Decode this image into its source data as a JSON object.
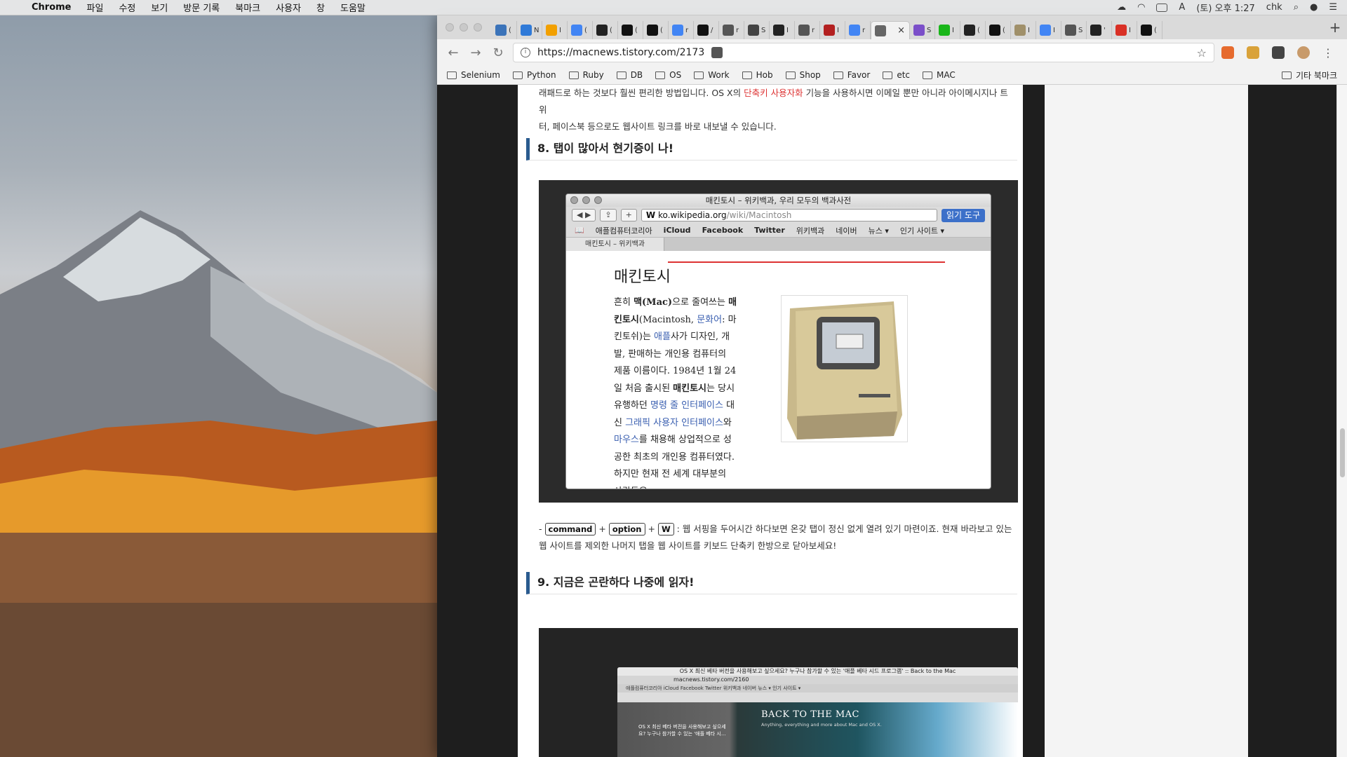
{
  "menubar": {
    "app": "Chrome",
    "items": [
      "파일",
      "수정",
      "보기",
      "방문 기록",
      "북마크",
      "사용자",
      "창",
      "도움말"
    ],
    "clock": "(토) 오후 1:27",
    "user": "chk"
  },
  "browser": {
    "tabs": [
      {
        "icon": "python-icon",
        "label": "(",
        "color": "#3b73b9"
      },
      {
        "icon": "globe-icon",
        "label": "N",
        "color": "#2f7ad8"
      },
      {
        "icon": "slides-icon",
        "label": "I",
        "color": "#f2a000"
      },
      {
        "icon": "google-icon",
        "label": "(",
        "color": "#4285f4"
      },
      {
        "icon": "x-icon",
        "label": "(",
        "color": "#222222"
      },
      {
        "icon": "github-icon",
        "label": "(",
        "color": "#111111"
      },
      {
        "icon": "github-icon",
        "label": "(",
        "color": "#111111"
      },
      {
        "icon": "google-icon",
        "label": "r",
        "color": "#4285f4"
      },
      {
        "icon": "htb-icon",
        "label": "/",
        "color": "#111111"
      },
      {
        "icon": "command-icon",
        "label": "r",
        "color": "#555555"
      },
      {
        "icon": "tool-icon",
        "label": "S",
        "color": "#444444"
      },
      {
        "icon": "im-icon",
        "label": "I",
        "color": "#222222"
      },
      {
        "icon": "command-icon",
        "label": "r",
        "color": "#555555"
      },
      {
        "icon": "m-icon",
        "label": "I",
        "color": "#b32020"
      },
      {
        "icon": "google-icon",
        "label": "r",
        "color": "#4285f4"
      },
      {
        "icon": "mac-icon",
        "label": "",
        "color": "#666666",
        "active": true
      },
      {
        "icon": "pinwheel-icon",
        "label": "S",
        "color": "#7b4fc9"
      },
      {
        "icon": "line-icon",
        "label": "I",
        "color": "#19b619"
      },
      {
        "icon": "terminal-icon",
        "label": "(",
        "color": "#222222"
      },
      {
        "icon": "github-icon",
        "label": "(",
        "color": "#111111"
      },
      {
        "icon": "image-icon",
        "label": "I",
        "color": "#a0906a"
      },
      {
        "icon": "google-icon",
        "label": "I",
        "color": "#4285f4"
      },
      {
        "icon": "command-icon",
        "label": "S",
        "color": "#555555"
      },
      {
        "icon": "dots-icon",
        "label": "'",
        "color": "#222222"
      },
      {
        "icon": "gmail-icon",
        "label": "I",
        "color": "#d93025"
      },
      {
        "icon": "github-icon",
        "label": "(",
        "color": "#111111"
      }
    ],
    "active_close": "×",
    "url": "https://macnews.tistory.com/2173",
    "bookmarks": [
      "Selenium",
      "Python",
      "Ruby",
      "DB",
      "OS",
      "Work",
      "Hob",
      "Shop",
      "Favor",
      "etc",
      "MAC"
    ],
    "other_bookmarks": "기타 북마크"
  },
  "article": {
    "intro_line1_a": "래패드로 하는 것보다 훨씬 편리한 방법입니다. OS X의 ",
    "intro_link": "단축키 사용자화",
    "intro_line1_b": " 기능을 사용하시면 이메일 뿐만 아니라 아이메시지나 트위",
    "intro_line2": "터, 페이스북 등으로도 웹사이트 링크를 바로 내보낼 수 있습니다.",
    "heading8": "8. 탭이 많아서 현기증이 나!",
    "heading9": "9. 지금은 곤란하다 나중에 읽자!",
    "shortcut_prefix": "-",
    "keys": [
      "command",
      "option",
      "W"
    ],
    "plus": "+",
    "shortcut_text": ": 웹 서핑을 두어시간 하다보면 온갖 탭이 정신 없게 열려 있기 마련이죠. 현재 바라보고 있는",
    "shortcut_text2": "웹 사이트를 제외한 나머지 탭을 웹 사이트를 키보드 단축키 한방으로 닫아보세요!"
  },
  "screenshot1": {
    "window_title": "매킨토시 – 위키백과, 우리 모두의 백과사전",
    "url_host": "ko.wikipedia.org",
    "url_path": "/wiki/Macintosh",
    "url_prefix": "W",
    "reader_button": "읽기 도구",
    "favorites": [
      "애플컴퓨터코리아",
      "iCloud",
      "Facebook",
      "Twitter",
      "위키백과",
      "네이버",
      "뉴스 ▾",
      "인기 사이트 ▾"
    ],
    "tab_label": "매킨토시 – 위키백과",
    "heading": "매킨토시",
    "paragraph": [
      {
        "t": "흔히 "
      },
      {
        "t": "맥(Mac)",
        "b": true
      },
      {
        "t": "으로 줄여쓰는 "
      },
      {
        "t": "매킨토시",
        "b": true
      },
      {
        "t": "(Macintosh, "
      },
      {
        "t": "문화어",
        "l": true
      },
      {
        "t": ": 마킨토쉬)는 "
      },
      {
        "t": "애플",
        "l": true
      },
      {
        "t": "사가 디자인, 개발, 판매하는 개인용 컴퓨터의 제품 이름이다. 1984년 1월 24일 처음 출시된 "
      },
      {
        "t": "매킨토시",
        "b": true
      },
      {
        "t": "는 당시 유행하던 "
      },
      {
        "t": "명령 줄 인터페이스",
        "l": true
      },
      {
        "t": " 대신 "
      },
      {
        "t": "그래픽 사용자 인터페이스",
        "l": true
      },
      {
        "t": "와 "
      },
      {
        "t": "마우스",
        "l": true
      },
      {
        "t": "를 채용해 상업적으로 성공한 최초의 개인용 컴퓨터였다. 하지만 현재 전 세계 대부분의 사람들은"
      }
    ]
  },
  "screenshot2": {
    "window_title": "OS X 최신 베타 버전을 사용해보고 싶으세요? 누구나 참가할 수 있는 '애플 베타 시드 프로그램' :: Back to the Mac",
    "url": "macnews.tistory.com/2160",
    "favorites": "애플컴퓨터코리아   iCloud   Facebook   Twitter   위키백과   네이버   뉴스 ▾   인기 사이트 ▾",
    "site_title": "BACK TO THE MAC",
    "site_sub": "Anything, everything and more about Mac and OS X.",
    "left_text": "OS X 최신 베타 버전을 사용해보고 싶으세요? 누구나 참가할 수 있는 '애플 베타 시..."
  }
}
